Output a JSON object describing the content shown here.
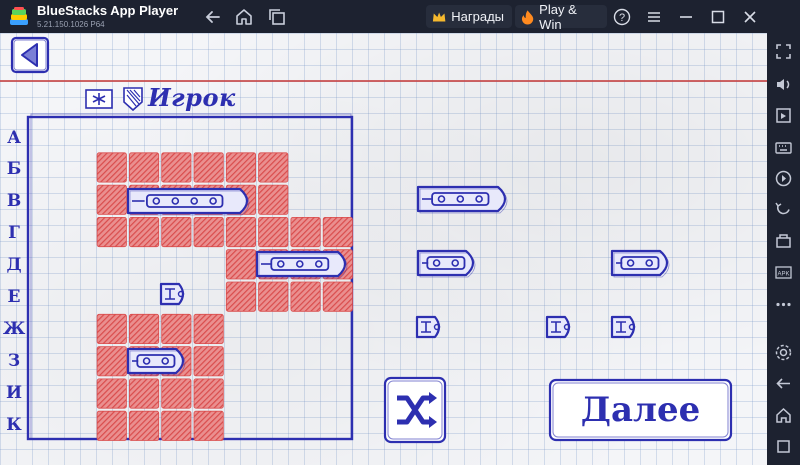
{
  "window": {
    "title": "BlueStacks App Player",
    "version": "5.21.150.1026  P64",
    "rewards_label": "Награды",
    "playwin_label": "Play & Win"
  },
  "game": {
    "player_label": "Игрок",
    "next_button_label": "Далее",
    "row_labels": [
      "А",
      "Б",
      "В",
      "Г",
      "Д",
      "Е",
      "Ж",
      "З",
      "И",
      "К"
    ],
    "colors": {
      "ink": "#2d2fb0",
      "hatch": "#d94c4c",
      "margin_line": "#c84a4a"
    }
  },
  "sidebar": {
    "icons": [
      "fullscreen-icon",
      "volume-icon",
      "screenshot-toggle-icon",
      "keyboard-icon",
      "record-icon",
      "rotate-icon",
      "apk-manager-icon",
      "install-apk-icon",
      "more-icon",
      "settings-icon",
      "back-icon",
      "home-icon",
      "recents-icon"
    ]
  }
}
